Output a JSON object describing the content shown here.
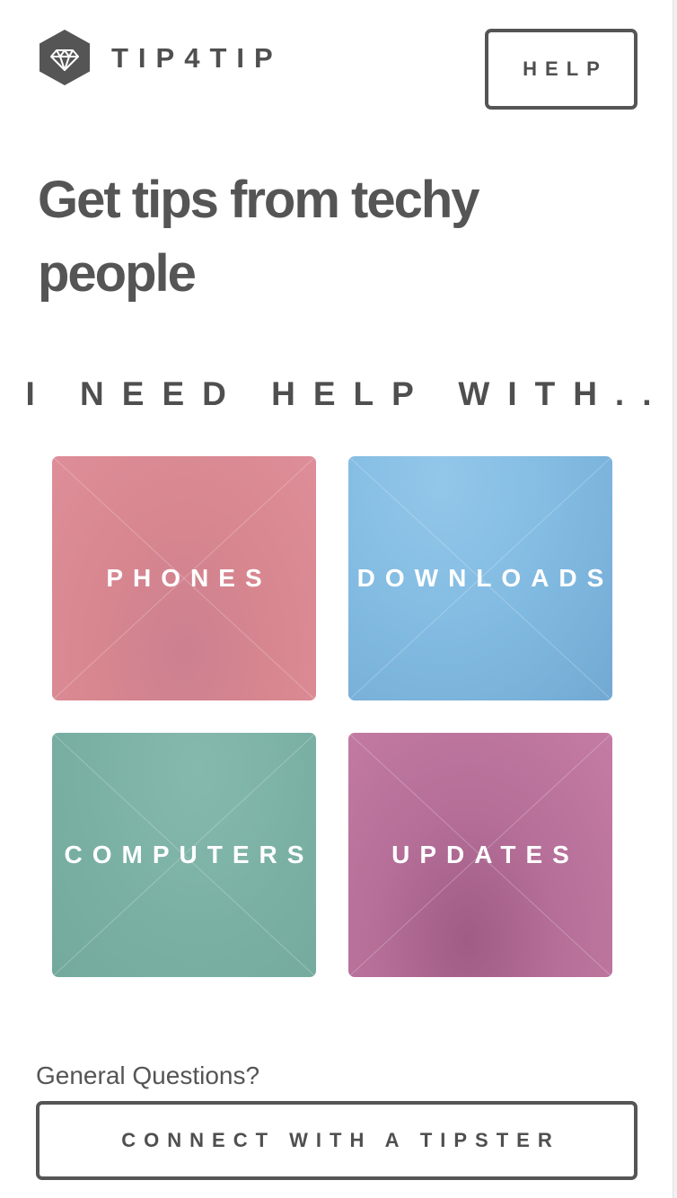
{
  "header": {
    "logo_icon": "diamond-hexagon-icon",
    "brand_name": "TIP4TIP",
    "help_label": "HELP"
  },
  "hero": {
    "headline": "Get tips from techy people"
  },
  "categories": {
    "prompt": "I NEED HELP WITH..",
    "items": [
      {
        "label": "PHONES",
        "color": "#d7868f"
      },
      {
        "label": "DOWNLOADS",
        "color": "#80b9e0"
      },
      {
        "label": "COMPUTERS",
        "color": "#7ab0a4"
      },
      {
        "label": "UPDATES",
        "color": "#b56f98"
      }
    ]
  },
  "footer": {
    "question": "General Questions?",
    "connect_label": "CONNECT WITH A TIPSTER"
  },
  "colors": {
    "text": "#535353",
    "border": "#555555"
  }
}
